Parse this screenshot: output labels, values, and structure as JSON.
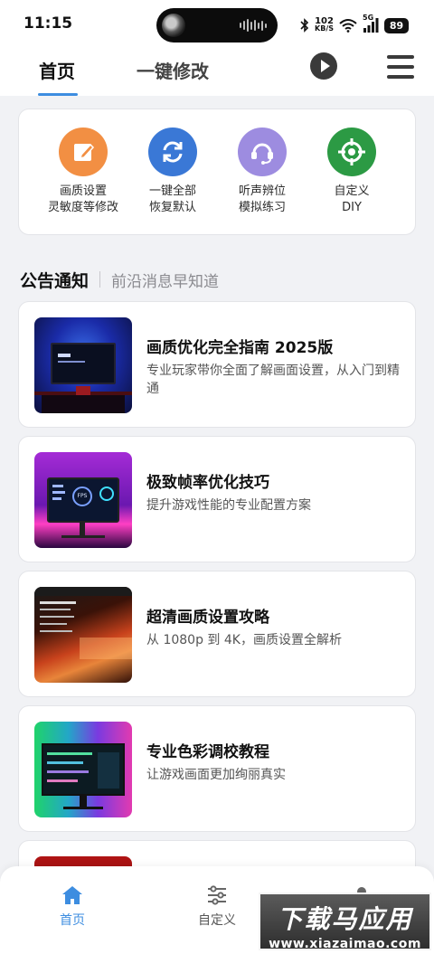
{
  "status_bar": {
    "time": "11:15",
    "net_speed_value": "102",
    "net_speed_unit": "KB/S",
    "network_type": "5G",
    "battery": "89"
  },
  "header": {
    "tabs": [
      {
        "label": "首页",
        "active": true
      },
      {
        "label": "一键修改",
        "active": false
      }
    ],
    "accent_color": "#3d8de0"
  },
  "quick_actions": [
    {
      "line1": "画质设置",
      "line2": "灵敏度等修改",
      "icon": "edit-icon",
      "color": "#f28f43"
    },
    {
      "line1": "一键全部",
      "line2": "恢复默认",
      "icon": "refresh-icon",
      "color": "#3a78d6"
    },
    {
      "line1": "听声辨位",
      "line2": "模拟练习",
      "icon": "headset-icon",
      "color": "#9d8ce0"
    },
    {
      "line1": "自定义",
      "line2": "DIY",
      "icon": "crosshair-icon",
      "color": "#2c9a44"
    }
  ],
  "section": {
    "title": "公告通知",
    "subtitle": "前沿消息早知道"
  },
  "articles": [
    {
      "title": "画质优化完全指南 2025版",
      "desc": "专业玩家带你全面了解画面设置，从入门到精通"
    },
    {
      "title": "极致帧率优化技巧",
      "desc": "提升游戏性能的专业配置方案",
      "thumb_text": "FPS"
    },
    {
      "title": "超清画质设置攻略",
      "desc": "从 1080p 到 4K，画质设置全解析"
    },
    {
      "title": "专业色彩调校教程",
      "desc": "让游戏画面更加绚丽真实"
    }
  ],
  "bottom_nav": [
    {
      "label": "首页",
      "icon": "home-icon",
      "active": true
    },
    {
      "label": "自定义",
      "icon": "sliders-icon",
      "active": false
    }
  ],
  "watermark": {
    "title": "下载马应用",
    "url": "www.xiazaimao.com"
  }
}
